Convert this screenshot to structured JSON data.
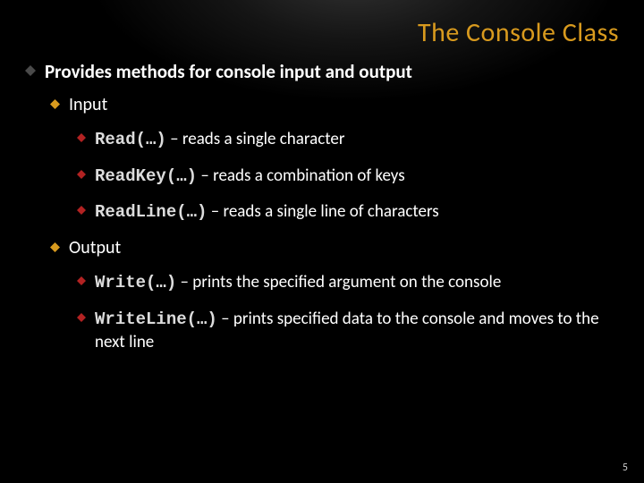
{
  "title": "The Console Class",
  "lvl1_intro": "Provides methods for console input and output",
  "input_label": "Input",
  "output_label": "Output",
  "methods": {
    "read_code": "Read(…)",
    "read_desc": " – reads a single character",
    "readkey_code": "ReadKey(…)",
    "readkey_desc": " – reads a combination of keys",
    "readline_code": "ReadLine(…)",
    "readline_desc": " – reads a single line of characters",
    "write_code": "Write(…)",
    "write_desc": " – prints the specified argument on the console",
    "writeline_code": "WriteLine(…)",
    "writeline_desc": " – prints specified data to the console and moves to the next line"
  },
  "page_number": "5",
  "colors": {
    "accent": "#d89a1e",
    "bullet_outer": "#4a4a4a",
    "bullet_accent": "#d89a1e",
    "bullet_red": "#b22222"
  }
}
